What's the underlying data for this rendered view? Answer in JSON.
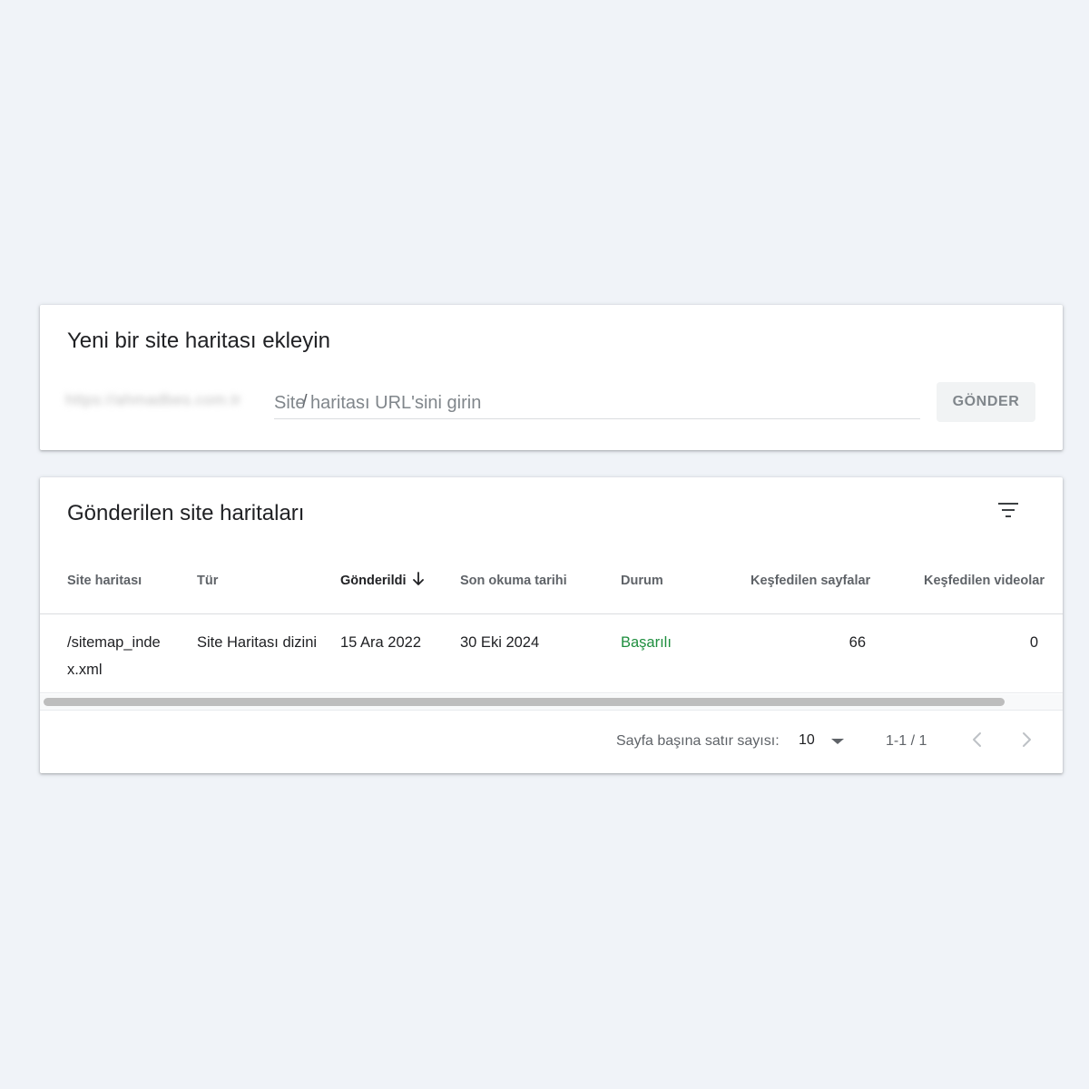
{
  "add_sitemap": {
    "title": "Yeni bir site haritası ekleyin",
    "url_prefix": "https://ahmadbes.com.tr",
    "slash": "/",
    "input_placeholder": "Site haritası URL'sini girin",
    "input_value": "",
    "submit_label": "GÖNDER"
  },
  "submitted": {
    "title": "Gönderilen site haritaları",
    "filter_icon": "filter-list-icon",
    "columns": [
      "Site haritası",
      "Tür",
      "Gönderildi",
      "Son okuma tarihi",
      "Durum",
      "Keşfedilen sayfalar",
      "Keşfedilen videolar"
    ],
    "sorted_column": "Gönderildi",
    "sort_direction": "descending",
    "rows": [
      {
        "sitemap": "/sitemap_index.xml",
        "type": "Site Haritası dizini",
        "submitted": "15 Ara 2022",
        "last_read": "30 Eki 2024",
        "status": "Başarılı",
        "discovered_pages": "66",
        "discovered_videos": "0"
      }
    ],
    "status_color": "#1e8e3e",
    "pagination": {
      "rows_per_page_label": "Sayfa başına satır sayısı:",
      "rows_per_page": "10",
      "range": "1-1 / 1"
    }
  }
}
